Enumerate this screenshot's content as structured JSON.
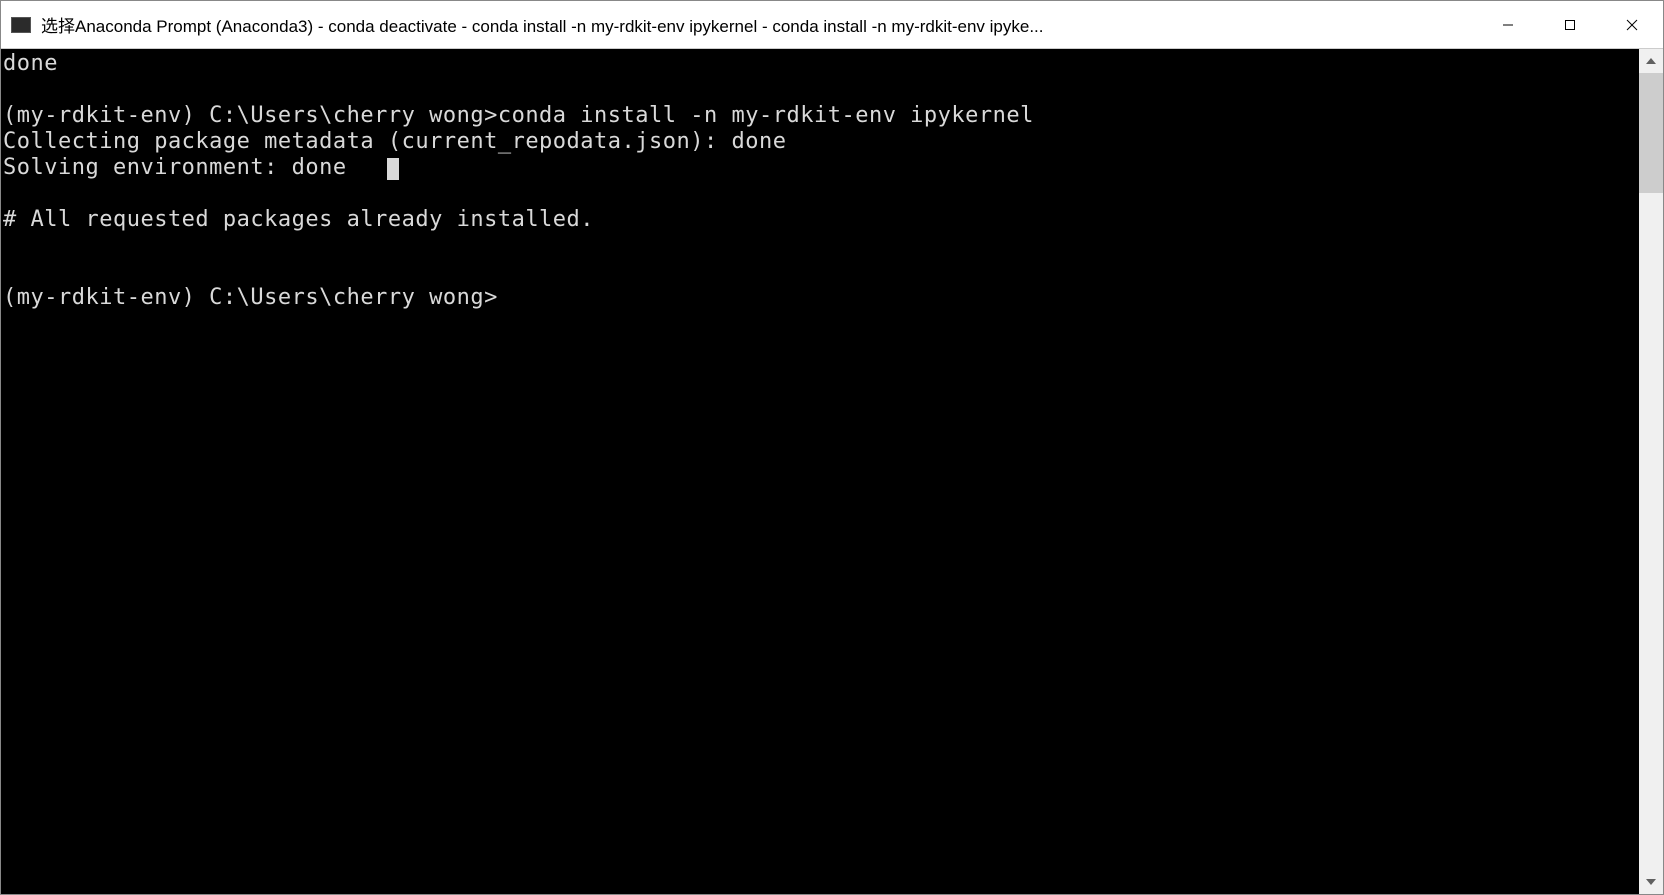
{
  "window": {
    "title": "选择Anaconda Prompt (Anaconda3) - conda  deactivate - conda  install -n my-rdkit-env ipykernel - conda  install -n my-rdkit-env ipyke..."
  },
  "terminal": {
    "lines": [
      "done",
      "",
      "(my-rdkit-env) C:\\Users\\cherry wong>conda install -n my-rdkit-env ipykernel",
      "Collecting package metadata (current_repodata.json): done",
      "Solving environment: done",
      "",
      "# All requested packages already installed.",
      "",
      "",
      "(my-rdkit-env) C:\\Users\\cherry wong>"
    ],
    "cursor_line": 4
  }
}
